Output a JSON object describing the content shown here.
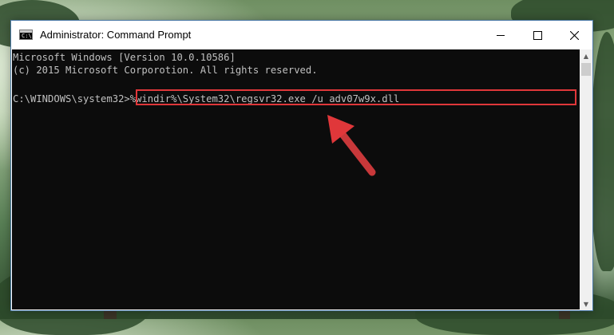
{
  "window": {
    "title": "Administrator: Command Prompt",
    "icon": "cmd-icon",
    "controls": {
      "minimize": "minimize-icon",
      "maximize": "maximize-icon",
      "close": "close-icon"
    }
  },
  "console": {
    "lines": [
      "Microsoft Windows [Version 10.0.10586]",
      "(c) 2015 Microsoft Corporotion. All rights reserved."
    ],
    "prompt": "C:\\WINDOWS\\system32>",
    "command": "%windir%\\System32\\regsvr32.exe /u adv07w9x.dll"
  },
  "colors": {
    "console_bg": "#0c0c0c",
    "console_text": "#c0c0c0",
    "highlight": "#e0373a"
  }
}
